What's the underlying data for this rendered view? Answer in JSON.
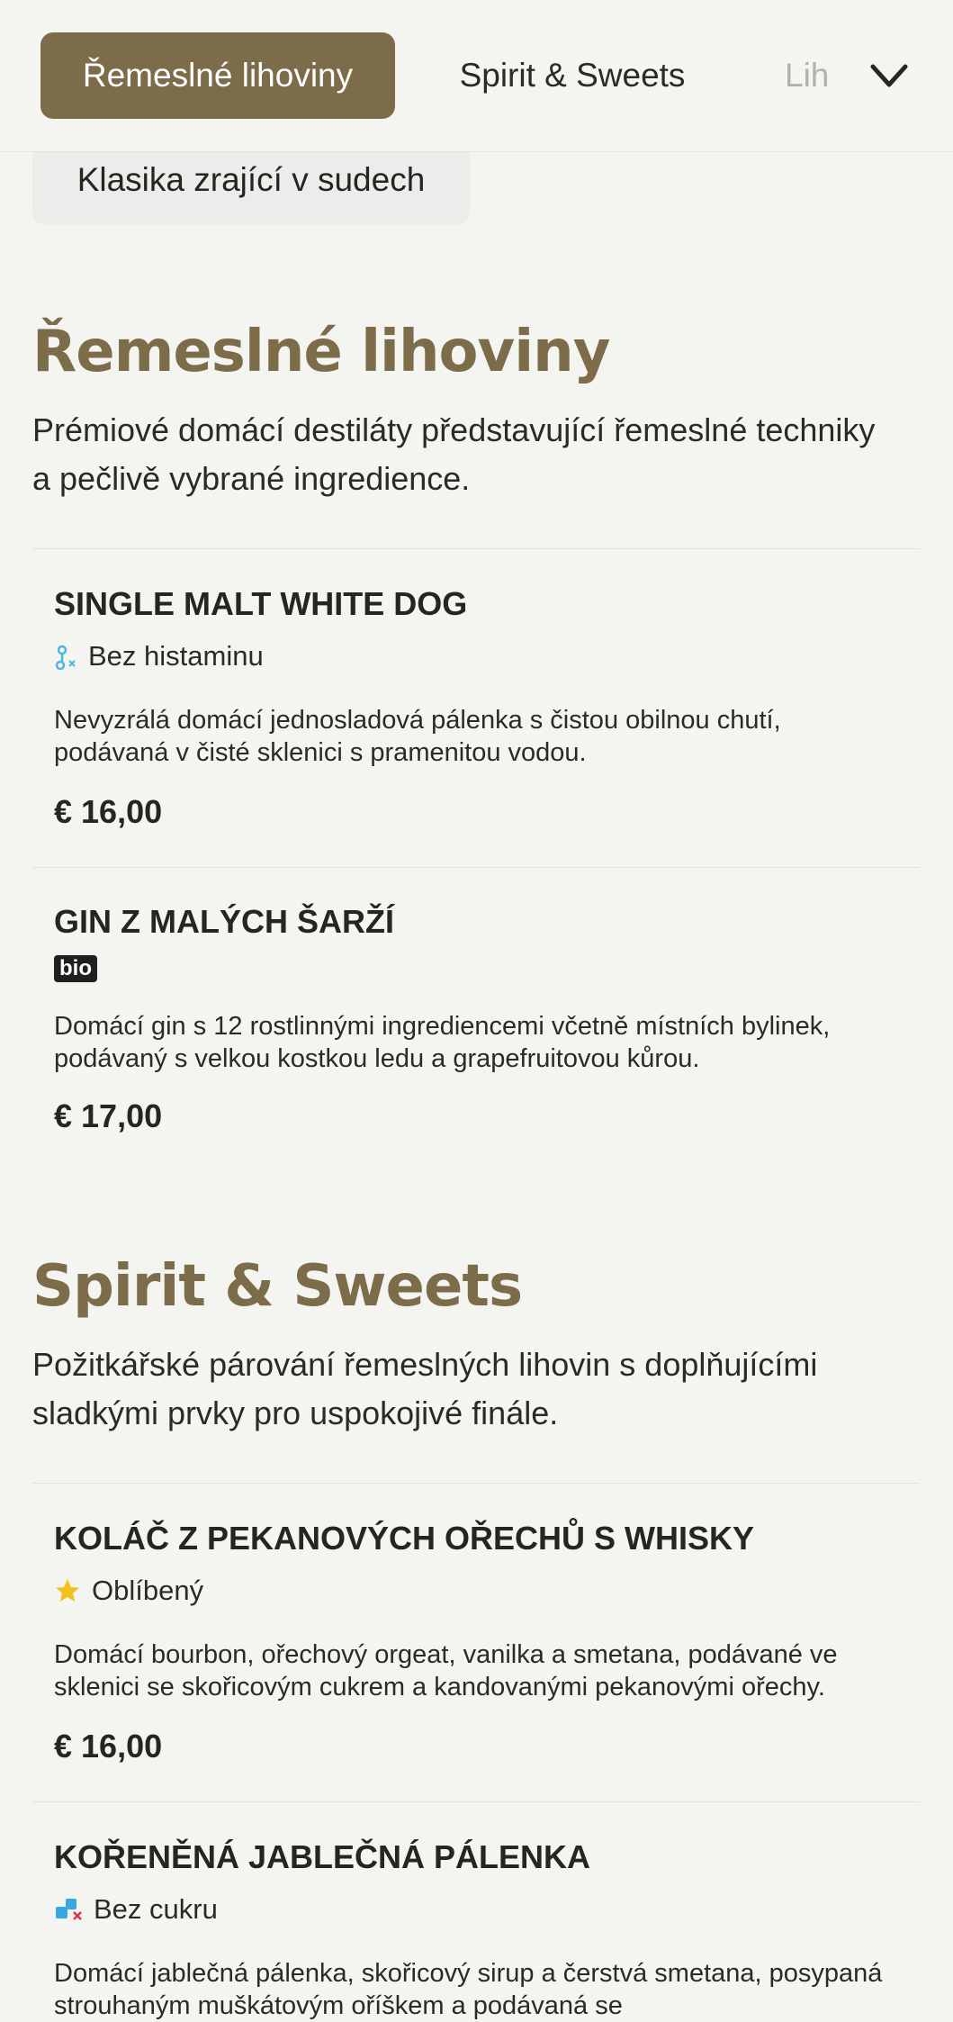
{
  "nav": {
    "tabs": [
      {
        "label": "Řemeslné lihoviny",
        "active": true
      },
      {
        "label": "Spirit & Sweets",
        "active": false
      },
      {
        "label": "Liho",
        "active": false
      }
    ],
    "expand_icon": "chevron-down-icon",
    "subtab": "Klasika zrající v sudech"
  },
  "colors": {
    "accent": "#7d6c49",
    "background": "#f4f4f0",
    "star": "#f2c21a",
    "histamine": "#4fb6dd",
    "sugar": "#3aa8e0"
  },
  "sections": [
    {
      "title": "Řemeslné lihoviny",
      "description": "Prémiové domácí destiláty představující řemeslné techniky a pečlivě vybrané ingredience.",
      "items": [
        {
          "name": "SINGLE MALT WHITE DOG",
          "tag": {
            "icon": "histamine-free-icon",
            "label": "Bez histaminu"
          },
          "description": "Nevyzrálá domácí jednosladová pálenka s čistou obilnou chutí, podávaná v čisté sklenici s pramenitou vodou.",
          "price": "€ 16,00"
        },
        {
          "name": "GIN Z MALÝCH ŠARŽÍ",
          "tag": {
            "badge": "bio"
          },
          "description": "Domácí gin s 12 rostlinnými ingrediencemi včetně místních bylinek, podávaný s velkou kostkou ledu a grapefruitovou kůrou.",
          "price": "€ 17,00"
        }
      ]
    },
    {
      "title": "Spirit & Sweets",
      "description": "Požitkářské párování řemeslných lihovin s doplňujícími sladkými prvky pro uspokojivé finále.",
      "items": [
        {
          "name": "KOLÁČ Z PEKANOVÝCH OŘECHŮ S WHISKY",
          "tag": {
            "icon": "star-icon",
            "label": "Oblíbený"
          },
          "description": "Domácí bourbon, ořechový orgeat, vanilka a smetana, podávané ve sklenici se skořicovým cukrem a kandovanými pekanovými ořechy.",
          "price": "€ 16,00"
        },
        {
          "name": "KOŘENĚNÁ JABLEČNÁ PÁLENKA",
          "tag": {
            "icon": "sugar-free-icon",
            "label": "Bez cukru"
          },
          "description": "Domácí jablečná pálenka, skořicový sirup a čerstvá smetana, posypaná strouhaným muškátovým oříškem a podávaná se"
        }
      ]
    }
  ]
}
